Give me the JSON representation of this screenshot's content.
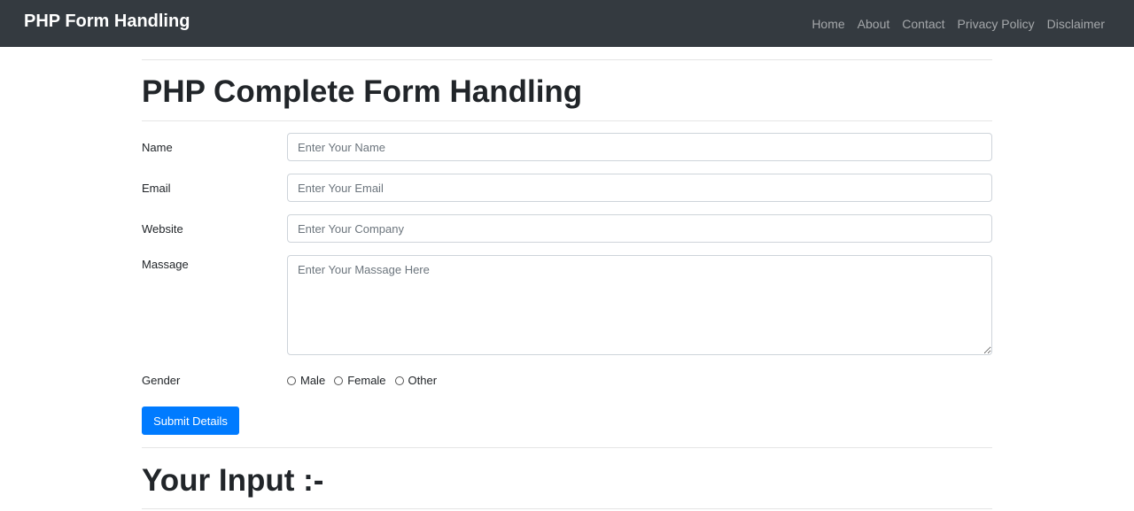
{
  "navbar": {
    "brand": "PHP Form Handling",
    "links": [
      "Home",
      "About",
      "Contact",
      "Privacy Policy",
      "Disclaimer"
    ]
  },
  "page": {
    "title": "PHP Complete Form Handling",
    "output_title": "Your Input :-"
  },
  "form": {
    "name": {
      "label": "Name",
      "placeholder": "Enter Your Name",
      "value": ""
    },
    "email": {
      "label": "Email",
      "placeholder": "Enter Your Email",
      "value": ""
    },
    "website": {
      "label": "Website",
      "placeholder": "Enter Your Company",
      "value": ""
    },
    "message": {
      "label": "Massage",
      "placeholder": "Enter Your Massage Here",
      "value": ""
    },
    "gender": {
      "label": "Gender",
      "options": [
        "Male",
        "Female",
        "Other"
      ],
      "selected": null
    },
    "submit_label": "Submit Details"
  },
  "colors": {
    "navbar_bg": "#343a40",
    "primary": "#007bff"
  }
}
